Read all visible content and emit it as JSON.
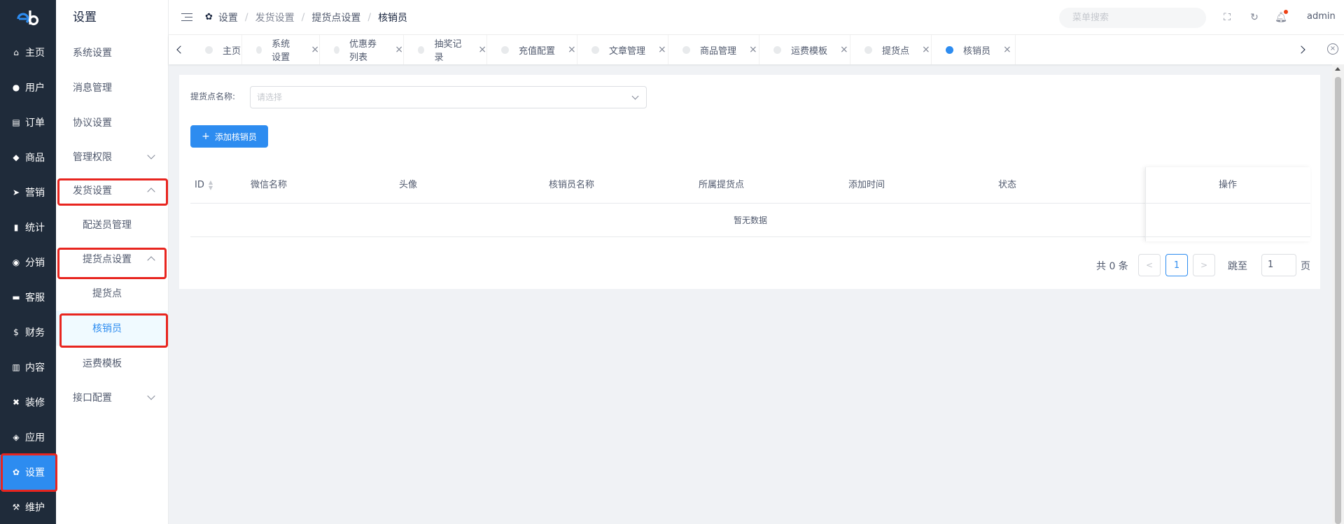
{
  "rail": {
    "logo": "eb",
    "items": [
      {
        "label": "主页",
        "icon": "home-icon",
        "glyph": "⌂"
      },
      {
        "label": "用户",
        "icon": "user-icon",
        "glyph": "●"
      },
      {
        "label": "订单",
        "icon": "cart-icon",
        "glyph": "▤"
      },
      {
        "label": "商品",
        "icon": "basket-icon",
        "glyph": "◆"
      },
      {
        "label": "营销",
        "icon": "send-icon",
        "glyph": "➤"
      },
      {
        "label": "统计",
        "icon": "bar-chart-icon",
        "glyph": "▮"
      },
      {
        "label": "分销",
        "icon": "distribution-icon",
        "glyph": "◉"
      },
      {
        "label": "客服",
        "icon": "chat-icon",
        "glyph": "▬"
      },
      {
        "label": "财务",
        "icon": "dollar-icon",
        "glyph": "$"
      },
      {
        "label": "内容",
        "icon": "book-icon",
        "glyph": "▥"
      },
      {
        "label": "装修",
        "icon": "tools-icon",
        "glyph": "✖"
      },
      {
        "label": "应用",
        "icon": "app-icon",
        "glyph": "◈"
      },
      {
        "label": "设置",
        "icon": "gear-icon",
        "glyph": "✿"
      },
      {
        "label": "维护",
        "icon": "hammer-icon",
        "glyph": "⚒"
      }
    ]
  },
  "submenu": {
    "title": "设置",
    "items": [
      {
        "label": "系统设置"
      },
      {
        "label": "消息管理"
      },
      {
        "label": "协议设置"
      },
      {
        "label": "管理权限"
      },
      {
        "label": "发货设置"
      },
      {
        "label": "配送员管理"
      },
      {
        "label": "提货点设置"
      },
      {
        "label": "提货点"
      },
      {
        "label": "核销员"
      },
      {
        "label": "运费模板"
      },
      {
        "label": "接口配置"
      }
    ]
  },
  "header": {
    "breadcrumb": [
      "设置",
      "发货设置",
      "提货点设置",
      "核销员"
    ],
    "search_placeholder": "菜单搜索",
    "user": "admin",
    "icons": [
      "fullscreen-icon",
      "refresh-icon",
      "bell-icon"
    ]
  },
  "tabs": [
    {
      "label": "主页"
    },
    {
      "label": "系统设置"
    },
    {
      "label": "优惠券列表"
    },
    {
      "label": "抽奖记录"
    },
    {
      "label": "充值配置"
    },
    {
      "label": "文章管理"
    },
    {
      "label": "商品管理"
    },
    {
      "label": "运费模板"
    },
    {
      "label": "提货点"
    },
    {
      "label": "核销员"
    }
  ],
  "filter": {
    "label": "提货点名称:",
    "placeholder": "请选择"
  },
  "add_button": "添加核销员",
  "table": {
    "columns": [
      "ID",
      "微信名称",
      "头像",
      "核销员名称",
      "所属提货点",
      "添加时间",
      "状态",
      "操作"
    ],
    "empty_text": "暂无数据"
  },
  "pagination": {
    "total": "共 0 条",
    "current": "1",
    "goto_label": "跳至",
    "goto_value": "1",
    "page_suffix": "页"
  },
  "colors": {
    "accent": "#2d8cf0",
    "rail_bg": "#1f2b3a",
    "highlight_box": "#e8251f"
  }
}
